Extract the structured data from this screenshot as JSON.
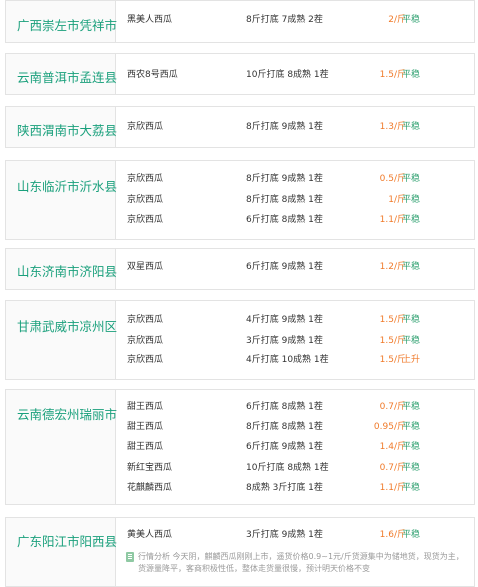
{
  "cards": [
    {
      "region": "广西崇左市凭祥市",
      "rows": [
        {
          "name": "黑美人西瓜",
          "spec": "8斤打底 7成熟 2茬",
          "price": "2/斤",
          "trend": "平稳"
        }
      ]
    },
    {
      "region": "云南普洱市孟连县",
      "rows": [
        {
          "name": "西农8号西瓜",
          "spec": "10斤打底 8成熟 1茬",
          "price": "1.5/斤",
          "trend": "平稳"
        }
      ]
    },
    {
      "region": "陕西渭南市大荔县",
      "rows": [
        {
          "name": "京欣西瓜",
          "spec": "8斤打底 9成熟 1茬",
          "price": "1.3/斤",
          "trend": "平稳"
        }
      ]
    },
    {
      "region": "山东临沂市沂水县",
      "rows": [
        {
          "name": "京欣西瓜",
          "spec": "8斤打底 9成熟 1茬",
          "price": "0.5/斤",
          "trend": "平稳"
        },
        {
          "name": "京欣西瓜",
          "spec": "8斤打底 8成熟 1茬",
          "price": "1/斤",
          "trend": "平稳"
        },
        {
          "name": "京欣西瓜",
          "spec": "6斤打底 8成熟 1茬",
          "price": "1.1/斤",
          "trend": "平稳"
        }
      ]
    },
    {
      "region": "山东济南市济阳县",
      "rows": [
        {
          "name": "双星西瓜",
          "spec": "6斤打底 9成熟 1茬",
          "price": "1.2/斤",
          "trend": "平稳"
        }
      ]
    },
    {
      "region": "甘肃武威市凉州区",
      "rows": [
        {
          "name": "京欣西瓜",
          "spec": "4斤打底 9成熟 1茬",
          "price": "1.5/斤",
          "trend": "平稳"
        },
        {
          "name": "京欣西瓜",
          "spec": "3斤打底 9成熟 1茬",
          "price": "1.5/斤",
          "trend": "平稳"
        },
        {
          "name": "京欣西瓜",
          "spec": "4斤打底 10成熟 1茬",
          "price": "1.5/斤",
          "trend": "上升"
        }
      ]
    },
    {
      "region": "云南德宏州瑞丽市",
      "rows": [
        {
          "name": "甜王西瓜",
          "spec": "6斤打底 8成熟 1茬",
          "price": "0.7/斤",
          "trend": "平稳"
        },
        {
          "name": "甜王西瓜",
          "spec": "8斤打底 8成熟 1茬",
          "price": "0.95/斤",
          "trend": "平稳"
        },
        {
          "name": "甜王西瓜",
          "spec": "6斤打底 9成熟 1茬",
          "price": "1.4/斤",
          "trend": "平稳"
        },
        {
          "name": "新红宝西瓜",
          "spec": "10斤打底 8成熟 1茬",
          "price": "0.7/斤",
          "trend": "平稳"
        },
        {
          "name": "花麒麟西瓜",
          "spec": "8成熟 3斤打底 1茬",
          "price": "1.1/斤",
          "trend": "平稳"
        }
      ]
    },
    {
      "region": "广东阳江市阳西县",
      "rows": [
        {
          "name": "黄美人西瓜",
          "spec": "3斤打底 9成熟 1茬",
          "price": "1.6/斤",
          "trend": "平稳"
        }
      ],
      "note": "行情分析 今天阴，麒麟西瓜刚刚上市，遥货价格0.9~1元/斤货源集中为储地货，现货为主，货源量降平，客商积极性低，整体走货量很慢，预计明天价格不变"
    }
  ]
}
